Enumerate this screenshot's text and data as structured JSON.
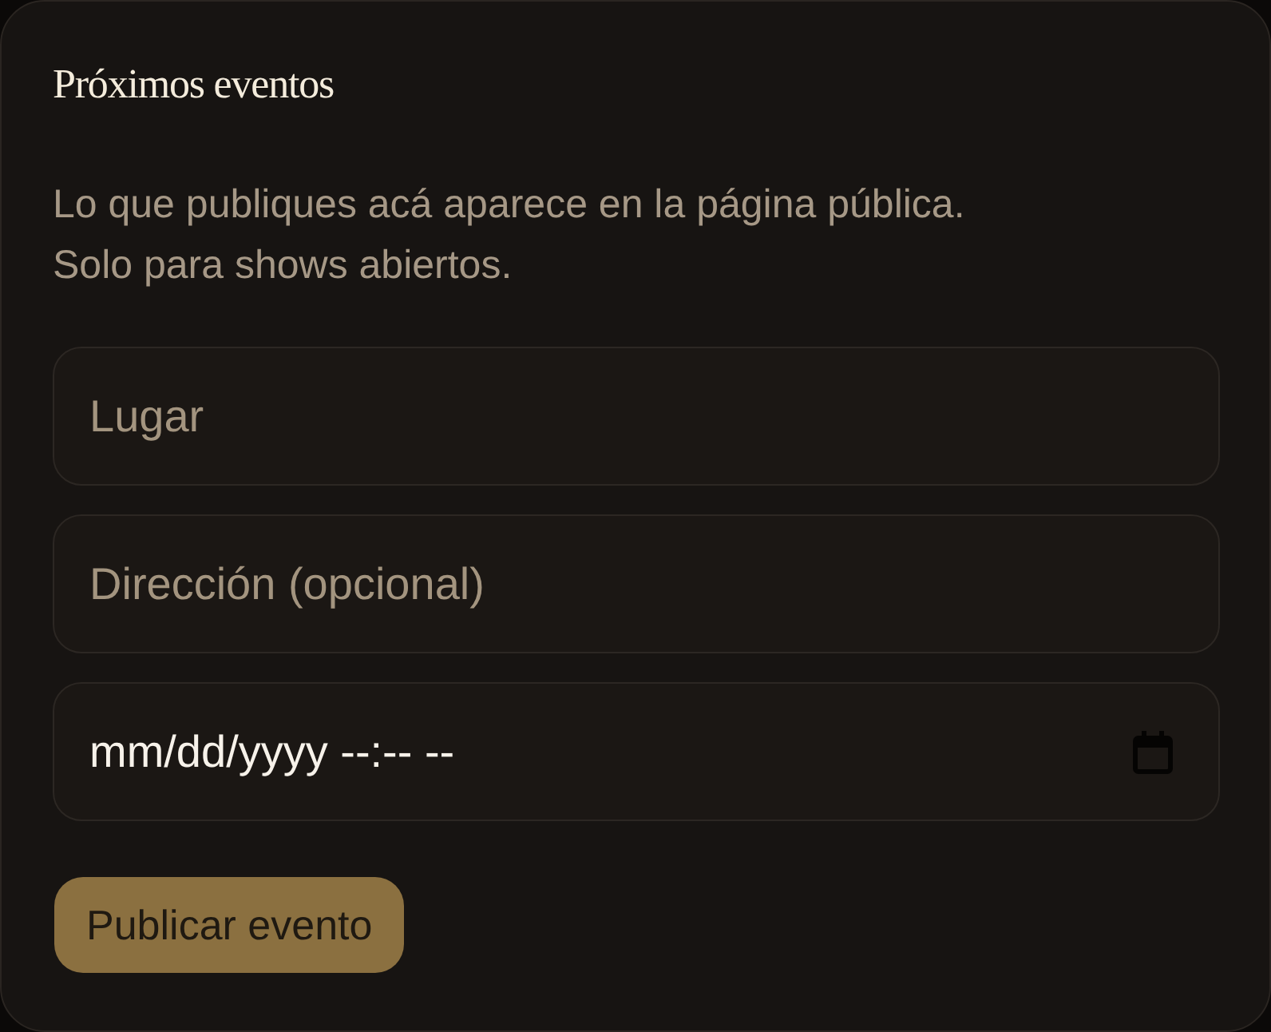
{
  "card": {
    "title": "Próximos eventos",
    "description": [
      "Lo que publiques acá aparece en la página pública.",
      "Solo para shows abiertos."
    ]
  },
  "fields": [
    {
      "kind": "text",
      "placeholder": "Lugar"
    },
    {
      "kind": "text",
      "placeholder": "Dirección (opcional)"
    },
    {
      "kind": "datetime",
      "value": "mm/dd/yyyy --:-- --"
    }
  ],
  "buttons": [
    {
      "label": "Publicar evento"
    }
  ]
}
